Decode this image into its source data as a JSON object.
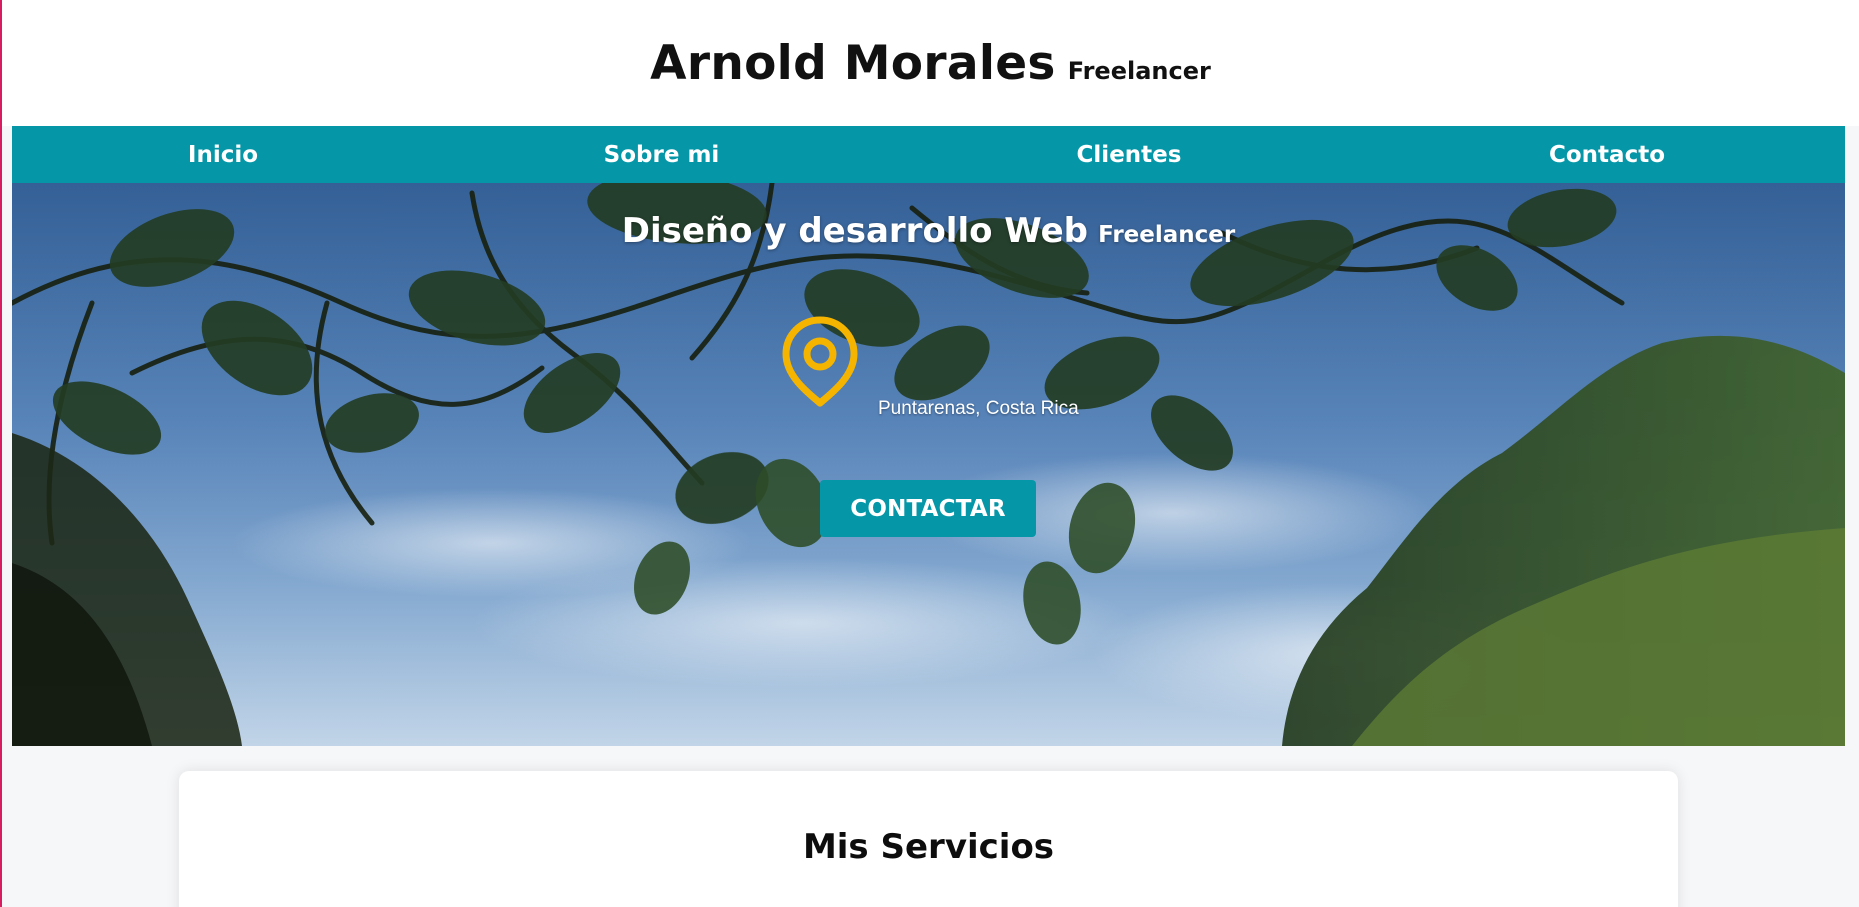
{
  "header": {
    "name": "Arnold Morales",
    "tag": "Freelancer"
  },
  "nav": {
    "items": [
      {
        "label": "Inicio"
      },
      {
        "label": "Sobre mi"
      },
      {
        "label": "Clientes"
      },
      {
        "label": "Contacto"
      }
    ]
  },
  "hero": {
    "title": "Diseño y desarrollo Web",
    "title_tag": "Freelancer",
    "location_icon": "location-pin-icon",
    "location": "Puntarenas, Costa Rica",
    "cta_label": "CONTACTAR"
  },
  "services": {
    "title": "Mis Servicios"
  },
  "colors": {
    "accent": "#0597a8",
    "pin": "#f4b400",
    "header_bg": "#ffffff",
    "page_bg": "#f6f7f9"
  }
}
